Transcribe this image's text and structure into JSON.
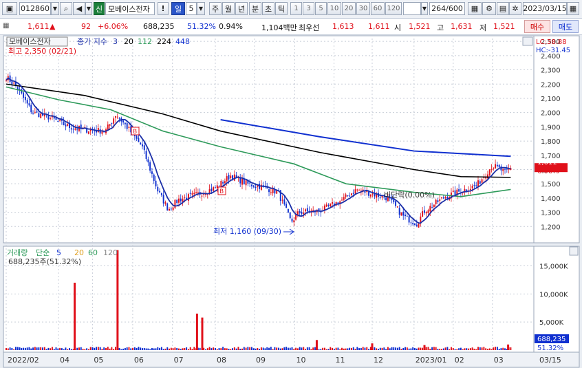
{
  "toolbar": {
    "code": "012860",
    "badge": "신",
    "name": "모베이스전자",
    "warn": "!",
    "period_sel": "일",
    "period_num": "5",
    "periods": [
      "주",
      "월",
      "년",
      "분",
      "초",
      "틱"
    ],
    "nums": [
      "1",
      "3",
      "5",
      "10",
      "20",
      "30",
      "60",
      "120"
    ],
    "count": "264",
    "count_total": "/600",
    "date": "2023/03/15"
  },
  "quote": {
    "price": "1,611",
    "arrow": "▲",
    "change": "92",
    "change_pct": "+6.06%",
    "volume": "688,235",
    "vol_ratio": "51.32%",
    "turnover": "0.94%",
    "amount": "1,104백만",
    "best_label": "최우선",
    "ask": "1,613",
    "bid": "1,611",
    "open_label": "시",
    "open": "1,521",
    "high_label": "고",
    "high": "1,631",
    "low_label": "저",
    "low": "1,521",
    "buy": "매수",
    "sell": "매도"
  },
  "colors": {
    "up": "#e0101a",
    "down": "#1030d0",
    "ma3": "#1b2fa8",
    "ma20": "#000000",
    "ma112": "#2e9a5a",
    "ma224": "#000000",
    "ma448": "#1030d0"
  },
  "chart_data": [
    {
      "type": "line",
      "title": "모베이스전자",
      "legend": {
        "label": "종가 지수",
        "periods": [
          "3",
          "20",
          "112",
          "224",
          "448"
        ]
      },
      "lc_label": "LC:38.88",
      "hc_label": "HC:-31.45",
      "ylim": [
        1100,
        2520
      ],
      "yticks": [
        "1,200",
        "1,300",
        "1,400",
        "1,500",
        "1,600",
        "1,700",
        "1,800",
        "1,900",
        "2,000",
        "2,100",
        "2,200",
        "2,300",
        "2,400",
        "2,500"
      ],
      "ytick_values": [
        1200,
        1300,
        1400,
        1500,
        1600,
        1700,
        1800,
        1900,
        2000,
        2100,
        2200,
        2300,
        2400,
        2500
      ],
      "xticks": [
        "2022/02",
        "04",
        "05",
        "06",
        "07",
        "08",
        "09",
        "10",
        "11",
        "12",
        "2023/01",
        "02",
        "03"
      ],
      "xtick_pos": [
        0.0,
        0.1,
        0.165,
        0.242,
        0.318,
        0.4,
        0.475,
        0.552,
        0.627,
        0.7,
        0.78,
        0.855,
        0.93
      ],
      "last_xlabel": "03/15",
      "close_anchors": [
        [
          0,
          2250
        ],
        [
          0.02,
          2180
        ],
        [
          0.05,
          2000
        ],
        [
          0.08,
          1970
        ],
        [
          0.12,
          1900
        ],
        [
          0.15,
          1880
        ],
        [
          0.19,
          1870
        ],
        [
          0.21,
          1990
        ],
        [
          0.235,
          1880
        ],
        [
          0.26,
          1760
        ],
        [
          0.29,
          1450
        ],
        [
          0.31,
          1320
        ],
        [
          0.33,
          1390
        ],
        [
          0.36,
          1420
        ],
        [
          0.4,
          1470
        ],
        [
          0.43,
          1560
        ],
        [
          0.46,
          1500
        ],
        [
          0.49,
          1480
        ],
        [
          0.52,
          1440
        ],
        [
          0.545,
          1230
        ],
        [
          0.56,
          1300
        ],
        [
          0.6,
          1310
        ],
        [
          0.64,
          1380
        ],
        [
          0.67,
          1460
        ],
        [
          0.7,
          1430
        ],
        [
          0.73,
          1400
        ],
        [
          0.76,
          1270
        ],
        [
          0.785,
          1220
        ],
        [
          0.8,
          1310
        ],
        [
          0.84,
          1410
        ],
        [
          0.87,
          1450
        ],
        [
          0.9,
          1490
        ],
        [
          0.93,
          1630
        ],
        [
          0.955,
          1580
        ],
        [
          0.965,
          1611
        ]
      ],
      "ma448": [
        [
          0.41,
          1950
        ],
        [
          0.6,
          1830
        ],
        [
          0.78,
          1730
        ],
        [
          0.965,
          1693
        ]
      ],
      "ma224": [
        [
          0,
          2200
        ],
        [
          0.15,
          2120
        ],
        [
          0.3,
          1990
        ],
        [
          0.41,
          1870
        ],
        [
          0.6,
          1720
        ],
        [
          0.78,
          1600
        ],
        [
          0.87,
          1550
        ],
        [
          0.965,
          1545
        ]
      ],
      "ma112": [
        [
          0,
          2180
        ],
        [
          0.1,
          2090
        ],
        [
          0.2,
          2020
        ],
        [
          0.3,
          1870
        ],
        [
          0.41,
          1760
        ],
        [
          0.55,
          1640
        ],
        [
          0.65,
          1500
        ],
        [
          0.78,
          1440
        ],
        [
          0.87,
          1410
        ],
        [
          0.965,
          1460
        ]
      ],
      "annotations": {
        "high": "최고 2,350 (02/21)",
        "low": "최저 1,160 (09/30)",
        "mid": "비단락(0.00%)",
        "last_price": "1,611",
        "last_pct": "6.06%",
        "b_marker": "B"
      }
    },
    {
      "type": "bar",
      "title": "거래량",
      "legend": {
        "label": "단순",
        "periods": [
          "5",
          "20",
          "60",
          "120"
        ]
      },
      "current": "688,235주(51.32%)",
      "ylim": [
        0,
        18000
      ],
      "yticks": [
        "5,000K",
        "10,000K",
        "15,000K"
      ],
      "ytick_values": [
        5000,
        10000,
        15000
      ],
      "spikes": [
        [
          0.131,
          12000
        ],
        [
          0.213,
          17800
        ],
        [
          0.365,
          6500
        ],
        [
          0.375,
          5800
        ],
        [
          0.594,
          1800
        ],
        [
          0.7,
          1200
        ],
        [
          0.8,
          900
        ],
        [
          0.96,
          1000
        ]
      ],
      "last_value": "688,235",
      "last_pct": "51.32%"
    }
  ]
}
